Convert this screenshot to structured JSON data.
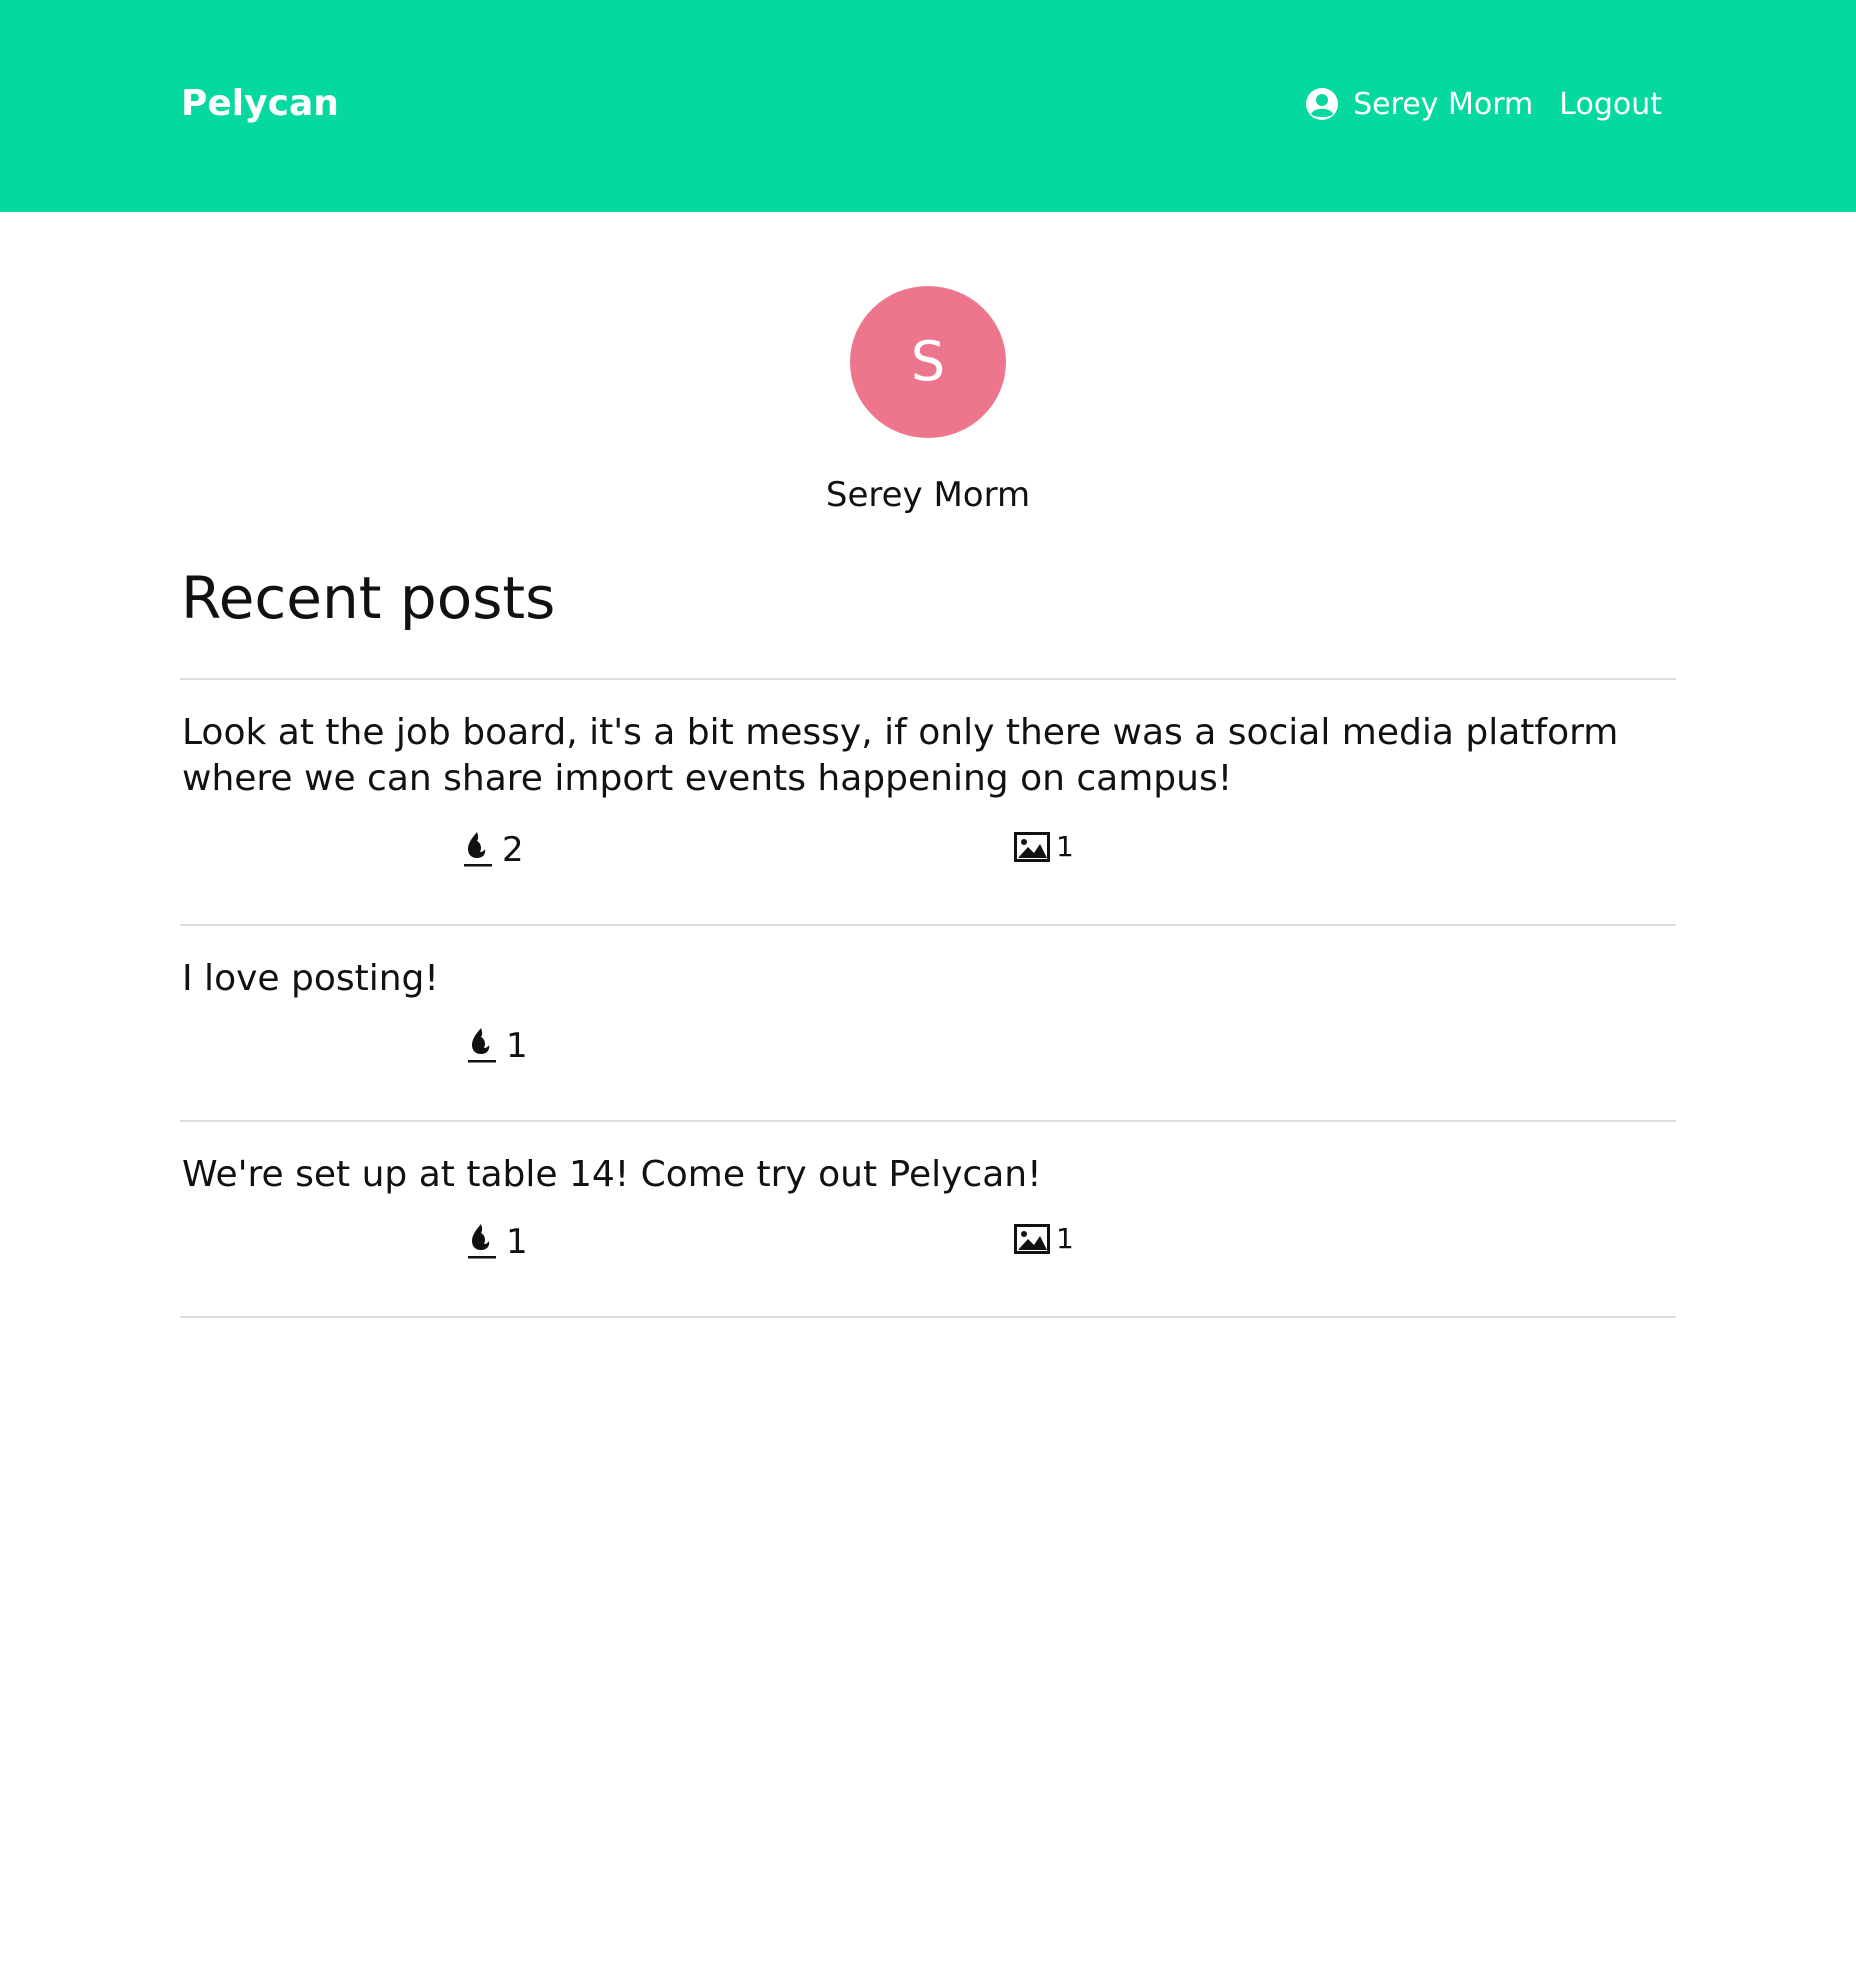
{
  "navbar": {
    "brand": "Pelycan",
    "user_name": "Serey Morm",
    "user_icon": "user-circle-icon",
    "logout_label": "Logout",
    "background": "#06d9a0"
  },
  "profile": {
    "avatar_letter": "S",
    "avatar_color": "#ee768c",
    "name": "Serey Morm"
  },
  "section": {
    "title": "Recent posts"
  },
  "posts": [
    {
      "text": "Look at the job board, it's a bit messy, if only there was a social media platform where we can share import events happening on campus!",
      "fire_count": "2",
      "image_count": "1"
    },
    {
      "text": "I love posting!",
      "fire_count": "1"
    },
    {
      "text": "We're set up at table 14! Come try out Pelycan!",
      "fire_count": "1",
      "image_count": "1"
    }
  ]
}
